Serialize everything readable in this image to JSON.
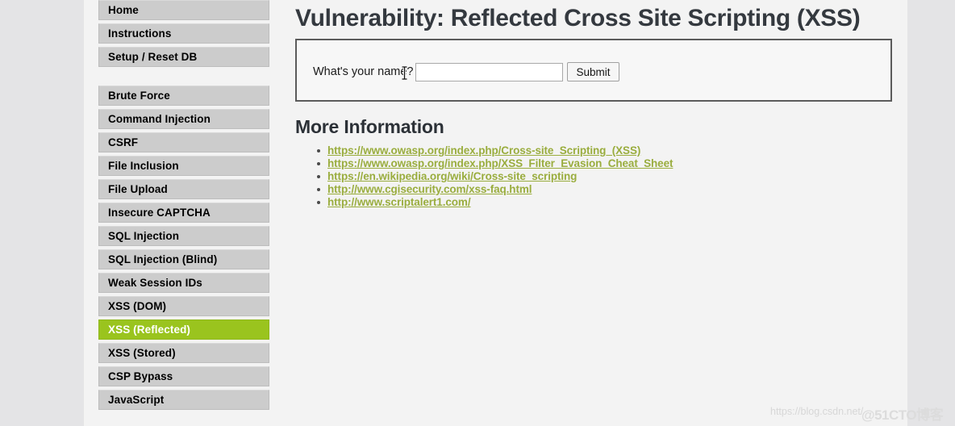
{
  "colors": {
    "accent_green": "#9ac41e",
    "link_olive": "#9aad3e",
    "sidebar_button": "#cccccc",
    "page_background": "#f3f3f3",
    "outer_background": "#e4e4e6",
    "title_text": "#34393f"
  },
  "sidebar": {
    "groups": [
      {
        "items": [
          {
            "label": "Home",
            "active": false
          },
          {
            "label": "Instructions",
            "active": false
          },
          {
            "label": "Setup / Reset DB",
            "active": false
          }
        ]
      },
      {
        "items": [
          {
            "label": "Brute Force",
            "active": false
          },
          {
            "label": "Command Injection",
            "active": false
          },
          {
            "label": "CSRF",
            "active": false
          },
          {
            "label": "File Inclusion",
            "active": false
          },
          {
            "label": "File Upload",
            "active": false
          },
          {
            "label": "Insecure CAPTCHA",
            "active": false
          },
          {
            "label": "SQL Injection",
            "active": false
          },
          {
            "label": "SQL Injection (Blind)",
            "active": false
          },
          {
            "label": "Weak Session IDs",
            "active": false
          },
          {
            "label": "XSS (DOM)",
            "active": false
          },
          {
            "label": "XSS (Reflected)",
            "active": true
          },
          {
            "label": "XSS (Stored)",
            "active": false
          },
          {
            "label": "CSP Bypass",
            "active": false
          },
          {
            "label": "JavaScript",
            "active": false
          }
        ]
      }
    ]
  },
  "main": {
    "title": "Vulnerability: Reflected Cross Site Scripting (XSS)",
    "form": {
      "label": "What's your name?",
      "input_value": "",
      "input_placeholder": "",
      "submit_label": "Submit"
    },
    "more_information": {
      "heading": "More Information",
      "links": [
        "https://www.owasp.org/index.php/Cross-site_Scripting_(XSS)",
        "https://www.owasp.org/index.php/XSS_Filter_Evasion_Cheat_Sheet",
        "https://en.wikipedia.org/wiki/Cross-site_scripting",
        "http://www.cgisecurity.com/xss-faq.html",
        "http://www.scriptalert1.com/"
      ]
    }
  },
  "watermarks": {
    "url": "https://blog.csdn.net/",
    "brand": "@51CTO博客"
  },
  "cursor": {
    "type": "text-ibeam-cursor"
  }
}
